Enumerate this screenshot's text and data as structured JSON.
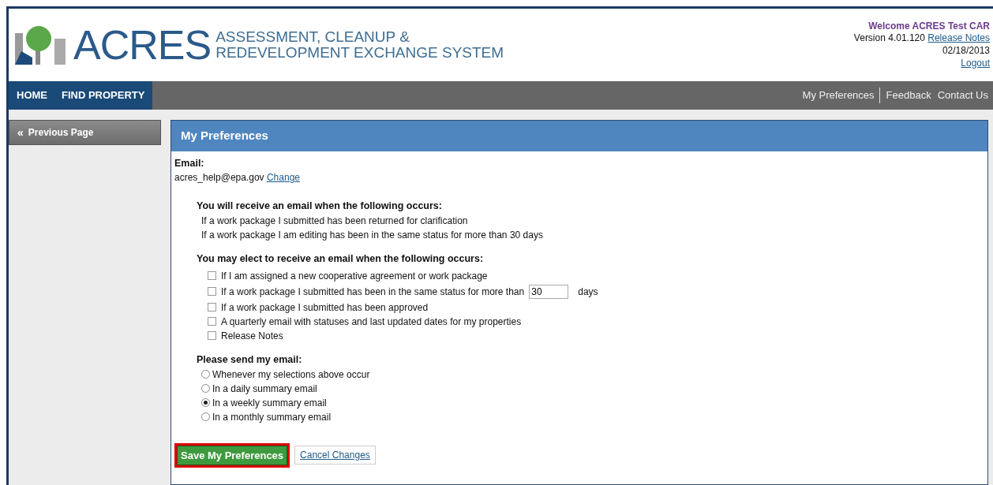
{
  "header": {
    "logo": "ACRES",
    "subtitle_lines": [
      "ASSESSMENT, CLEANUP &",
      "REDEVELOPMENT EXCHANGE SYSTEM"
    ],
    "welcome": "Welcome ACRES Test CAR",
    "version": "Version 4.01.120",
    "release_notes_link": "Release Notes",
    "date": "02/18/2013",
    "logout": "Logout"
  },
  "nav": {
    "left": [
      {
        "label": "HOME",
        "selected": false
      },
      {
        "label": "FIND PROPERTY",
        "selected": false
      }
    ],
    "right": [
      {
        "label": "My Preferences",
        "divider": true
      },
      {
        "label": "Feedback",
        "divider": false
      },
      {
        "label": "Contact Us",
        "divider": false
      }
    ]
  },
  "sidebar": {
    "back_icon": "«",
    "back_label": "Previous Page"
  },
  "panel": {
    "title": "My Preferences",
    "email_label": "Email:",
    "email": "acres_help@epa.gov",
    "change_link": "Change",
    "auto_heading": "You will receive an email when the following occurs:",
    "auto_items": [
      "If a work package I submitted has been returned for clarification",
      "If a work package I am editing has been in the same status for more than 30 days"
    ],
    "optional_heading": "You may elect to receive an email when the following occurs:",
    "options": [
      {
        "kind": "plain",
        "label": "If I am assigned a new cooperative agreement or work package",
        "checked": false
      },
      {
        "kind": "days",
        "label": "If a work package I submitted has been in the same status for more than",
        "value": "30",
        "suffix": "days",
        "checked": false
      },
      {
        "kind": "plain",
        "label": "If a work package I submitted has been approved",
        "checked": false
      },
      {
        "kind": "plain",
        "label": "A quarterly email with statuses and last updated dates for my properties",
        "checked": false
      },
      {
        "kind": "plain",
        "label": "Release Notes",
        "checked": false
      }
    ],
    "frequency_heading": "Please send my email:",
    "frequency": [
      {
        "label": "Whenever my selections above occur",
        "selected": false
      },
      {
        "label": "In a daily summary email",
        "selected": false
      },
      {
        "label": "In a weekly summary email",
        "selected": true
      },
      {
        "label": "In a monthly summary email",
        "selected": false
      }
    ],
    "save_button": "Save My Preferences",
    "cancel_button": "Cancel Changes"
  }
}
